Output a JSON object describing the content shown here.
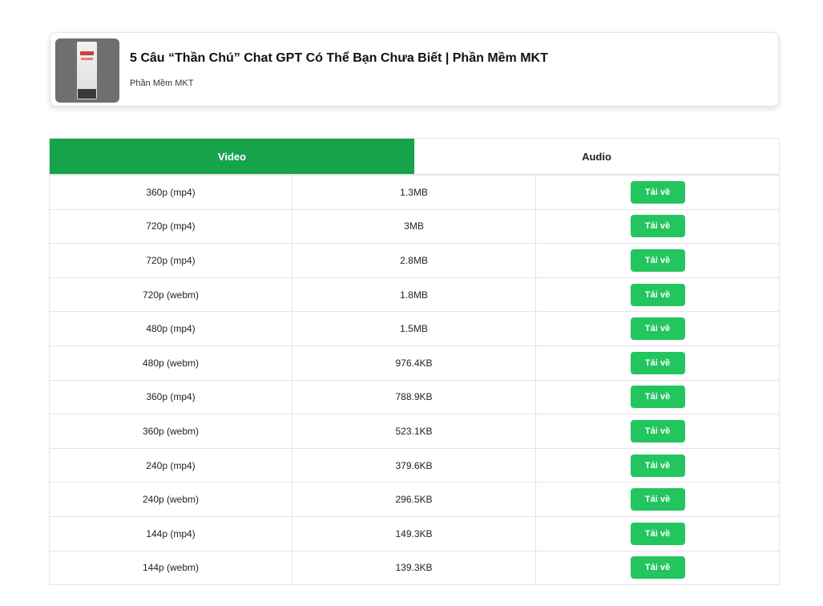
{
  "video": {
    "title": "5 Câu “Thần Chú” Chat GPT Có Thể Bạn Chưa Biết | Phần Mềm MKT",
    "channel": "Phần Mềm MKT"
  },
  "tabs": [
    {
      "label": "Video",
      "active": true
    },
    {
      "label": "Audio",
      "active": false
    }
  ],
  "rows": [
    {
      "quality": "360p (mp4)",
      "size": "1.3MB",
      "button": "Tải về"
    },
    {
      "quality": "720p (mp4)",
      "size": "3MB",
      "button": "Tải về"
    },
    {
      "quality": "720p (mp4)",
      "size": "2.8MB",
      "button": "Tải về"
    },
    {
      "quality": "720p (webm)",
      "size": "1.8MB",
      "button": "Tải về"
    },
    {
      "quality": "480p (mp4)",
      "size": "1.5MB",
      "button": "Tải về"
    },
    {
      "quality": "480p (webm)",
      "size": "976.4KB",
      "button": "Tải về"
    },
    {
      "quality": "360p (mp4)",
      "size": "788.9KB",
      "button": "Tải về"
    },
    {
      "quality": "360p (webm)",
      "size": "523.1KB",
      "button": "Tải về"
    },
    {
      "quality": "240p (mp4)",
      "size": "379.6KB",
      "button": "Tải về"
    },
    {
      "quality": "240p (webm)",
      "size": "296.5KB",
      "button": "Tải về"
    },
    {
      "quality": "144p (mp4)",
      "size": "149.3KB",
      "button": "Tải về"
    },
    {
      "quality": "144p (webm)",
      "size": "139.3KB",
      "button": "Tải về"
    }
  ],
  "colors": {
    "tab_active": "#16a34a",
    "download_button": "#22c55e"
  }
}
